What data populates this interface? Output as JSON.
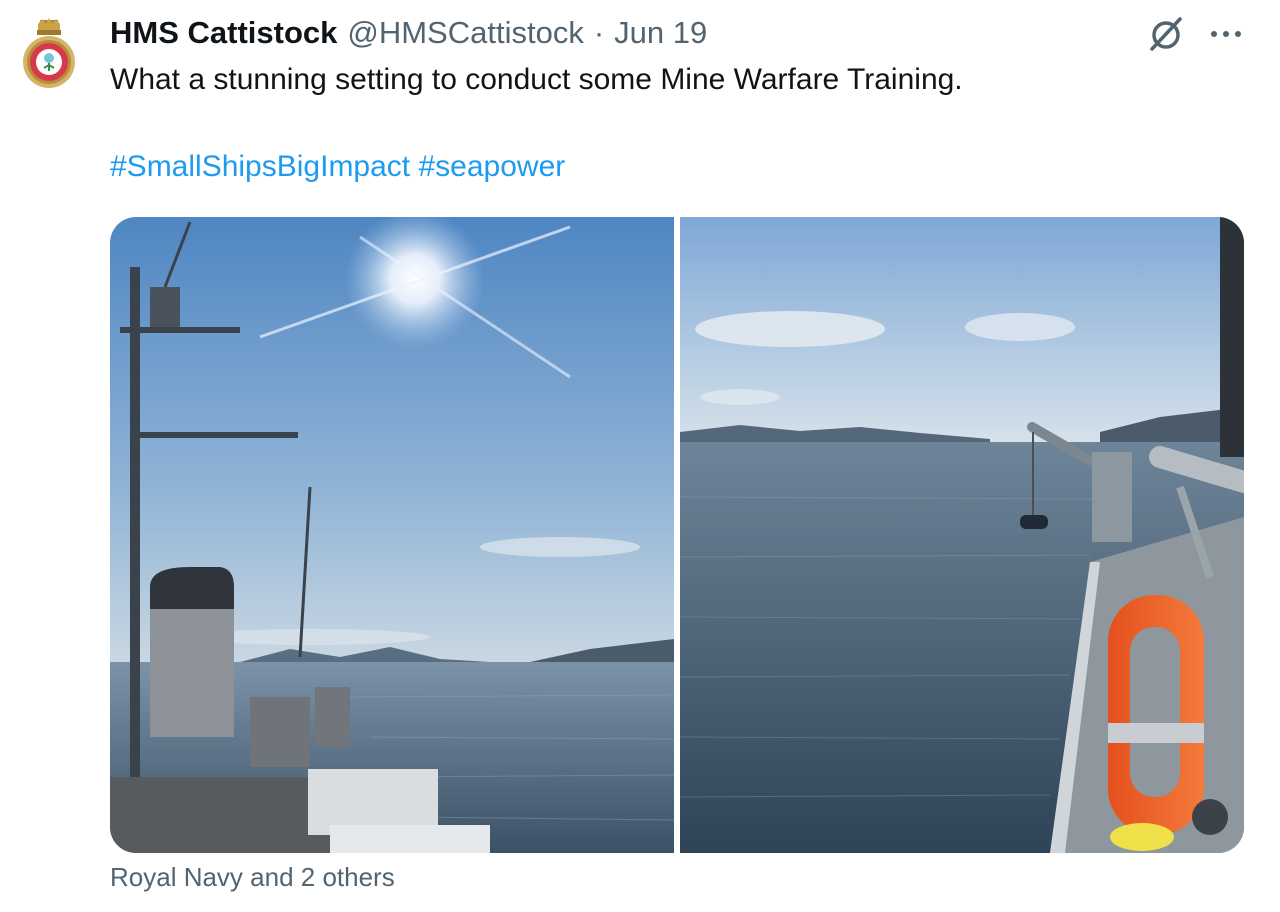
{
  "tweet": {
    "author_name": "HMS Cattistock",
    "author_handle": "@HMSCattistock",
    "separator": "·",
    "date": "Jun 19",
    "text": "What a stunning setting to conduct some Mine Warfare Training.",
    "hashtags": [
      "#SmallShipsBigImpact",
      "#seapower"
    ]
  },
  "footer": {
    "liked_by": "Royal Navy and 2 others"
  },
  "icons": {
    "avatar": "ship-crest-icon",
    "grok": "grok-icon",
    "more": "more-options-icon"
  },
  "colors": {
    "link": "#1d9bf0",
    "secondary_text": "#536471",
    "primary_text": "#0f1419"
  }
}
